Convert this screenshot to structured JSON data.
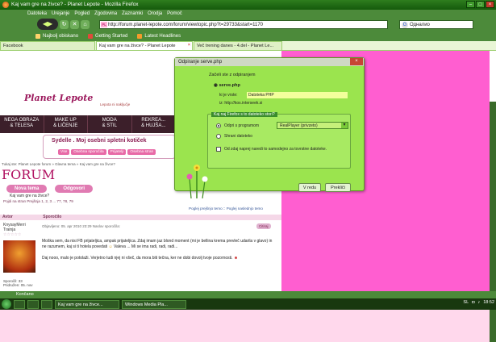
{
  "window": {
    "title": "Kaj vam gre na živce? - Planet Lepote - Mozilla Firefox"
  },
  "menu": [
    "Datoteka",
    "Urejanje",
    "Pogled",
    "Zgodovina",
    "Zaznamki",
    "Orodja",
    "Pomoč"
  ],
  "navbar": {
    "url": "http://forum.planet-lepote.com/forum/viewtopic.php?t=29733&start=1170",
    "search_value": "Одналио"
  },
  "bookmarks": [
    "Najbolj obiskano",
    "Getting Started",
    "Latest Headlines"
  ],
  "tabs": [
    {
      "label": "Facebook"
    },
    {
      "label": "Kaj vam gre na živce? - Planet Lepote"
    },
    {
      "label": "Več trening danes - 4.del - Planet Le..."
    }
  ],
  "page": {
    "logo": "Planet Lepote",
    "logo_sub": "Lepota ni naključje",
    "categories": [
      {
        "line1": "NEGA OBRAZA",
        "line2": "& TELESA"
      },
      {
        "line1": "MAKE UP",
        "line2": "& LIČENJE"
      },
      {
        "line1": "MODA",
        "line2": "& STIL"
      },
      {
        "line1": "REKREA...",
        "line2": "& HUJŠA..."
      }
    ],
    "sydelle_title": "Sydelle . Moj osebni spletni kotiček",
    "sydelle_chips": [
      "Vse",
      "Osebna sporočila",
      "Prijatelji",
      "Osebna stran"
    ],
    "breadcrumbs": "Tukaj ste: Planet Lepote forum » Glavna tema » Kaj vam gre na živce?",
    "forum_heading": "FORUM",
    "new_topic_button": "Nova tema",
    "reply_button": "Odgovori",
    "thread_title": "Kaj vam gre na živce?",
    "pager": "Pojdi na stran Prejšnja  1, 2, 3 ... 77, 78, 79",
    "topic_links": "Poglej prejšnjo temo :: Poglej naslednjo temo",
    "post_header_author": "Avtor",
    "post_header_message": "Sporočilo",
    "post": {
      "username": "KnysayMerri",
      "user_rank": "Trainja",
      "meta": "Objavljeno: 05. apr 2010 23:29  Naslov sporočila:",
      "quote_label": "Citiraj",
      "body_line1": "Moška sem, da nisi FB prijateljica, ampak prijateljica. Zdaj imam jaz blond moment (mi je bellina krema prevleč udarila v glavo) in ne razumem, kaj si ti hotela povedati ",
      "body_wink": "Valeva ... Mi se ima radi, radi, radi...",
      "body_line2": "Daj nooo, malo je potolaži. Verjetno tudi njej ni všeč, da mora biti tečna, ker ne dobi dovolj tvoje pozornosti. ",
      "stat_posts": "Sporočil: 33",
      "stat_joined": "Pridružen: 05. nov"
    }
  },
  "dialog": {
    "title": "Odpiranje serve.php",
    "intro": "Začeli ste z odpiranjem",
    "filename": "serve.php",
    "type_label": "ki je vrste:",
    "type_value": "Datoteka PHP",
    "from_label": "iz:",
    "from_value": "http://kos.interseek.si",
    "group_label": "Kaj naj Firefox s to datoteko stori?",
    "open_with_label": "Odpri s programom",
    "open_with_value": "RealPlayer (privzeto)",
    "save_label": "Shrani datoteko",
    "remember_label": "Od zdaj naprej naredi to samodejno za tovrstne datoteke.",
    "ok_button": "V redu",
    "cancel_button": "Prekliči"
  },
  "status": "Končano",
  "taskbar": {
    "items": [
      "Kaj vam gre na živce...",
      "Windows Media Pla..."
    ],
    "lang": "SL",
    "clock": "18:52"
  }
}
